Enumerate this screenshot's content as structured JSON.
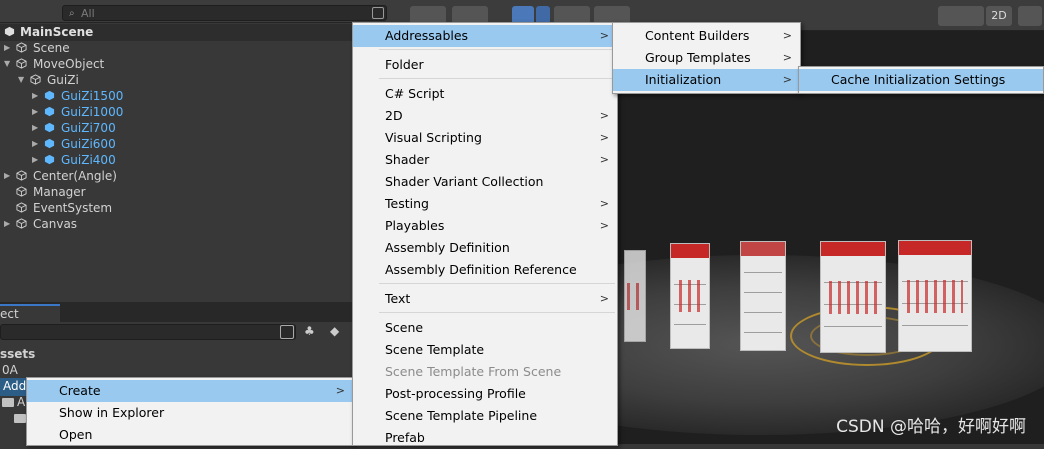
{
  "hierarchy": {
    "search_placeholder": "All",
    "items": [
      {
        "label": "MainScene"
      },
      {
        "label": "Scene"
      },
      {
        "label": "MoveObject"
      },
      {
        "label": "GuiZi"
      },
      {
        "label": "GuiZi1500"
      },
      {
        "label": "GuiZi1000"
      },
      {
        "label": "GuiZi700"
      },
      {
        "label": "GuiZi600"
      },
      {
        "label": "GuiZi400"
      },
      {
        "label": "Center(Angle)"
      },
      {
        "label": "Manager"
      },
      {
        "label": "EventSystem"
      },
      {
        "label": "Canvas"
      }
    ]
  },
  "project": {
    "tab_label": "ect",
    "assets_label": "ssets",
    "items": [
      {
        "label": "0A"
      },
      {
        "label": "Add"
      },
      {
        "label": "A"
      }
    ]
  },
  "context_menu": {
    "items": [
      {
        "label": "Create"
      },
      {
        "label": "Show in Explorer"
      },
      {
        "label": "Open"
      }
    ]
  },
  "create_menu": {
    "items": [
      {
        "label": "Addressables"
      },
      {
        "label": "Folder"
      },
      {
        "label": "C# Script"
      },
      {
        "label": "2D"
      },
      {
        "label": "Visual Scripting"
      },
      {
        "label": "Shader"
      },
      {
        "label": "Shader Variant Collection"
      },
      {
        "label": "Testing"
      },
      {
        "label": "Playables"
      },
      {
        "label": "Assembly Definition"
      },
      {
        "label": "Assembly Definition Reference"
      },
      {
        "label": "Text"
      },
      {
        "label": "Scene"
      },
      {
        "label": "Scene Template"
      },
      {
        "label": "Scene Template From Scene"
      },
      {
        "label": "Post-processing Profile"
      },
      {
        "label": "Scene Template Pipeline"
      },
      {
        "label": "Prefab"
      }
    ]
  },
  "addressables_menu": {
    "items": [
      {
        "label": "Content Builders"
      },
      {
        "label": "Group Templates"
      },
      {
        "label": "Initialization"
      }
    ]
  },
  "initialization_menu": {
    "items": [
      {
        "label": "Cache Initialization Settings"
      }
    ]
  },
  "scene_view": {
    "toolbar_2d_label": "2D"
  },
  "watermark": "CSDN @哈哈，好啊好啊",
  "colors": {
    "highlight": "#99c9ef",
    "prefab_blue": "#5fb8ff",
    "menu_bg": "#f2f2f2"
  }
}
